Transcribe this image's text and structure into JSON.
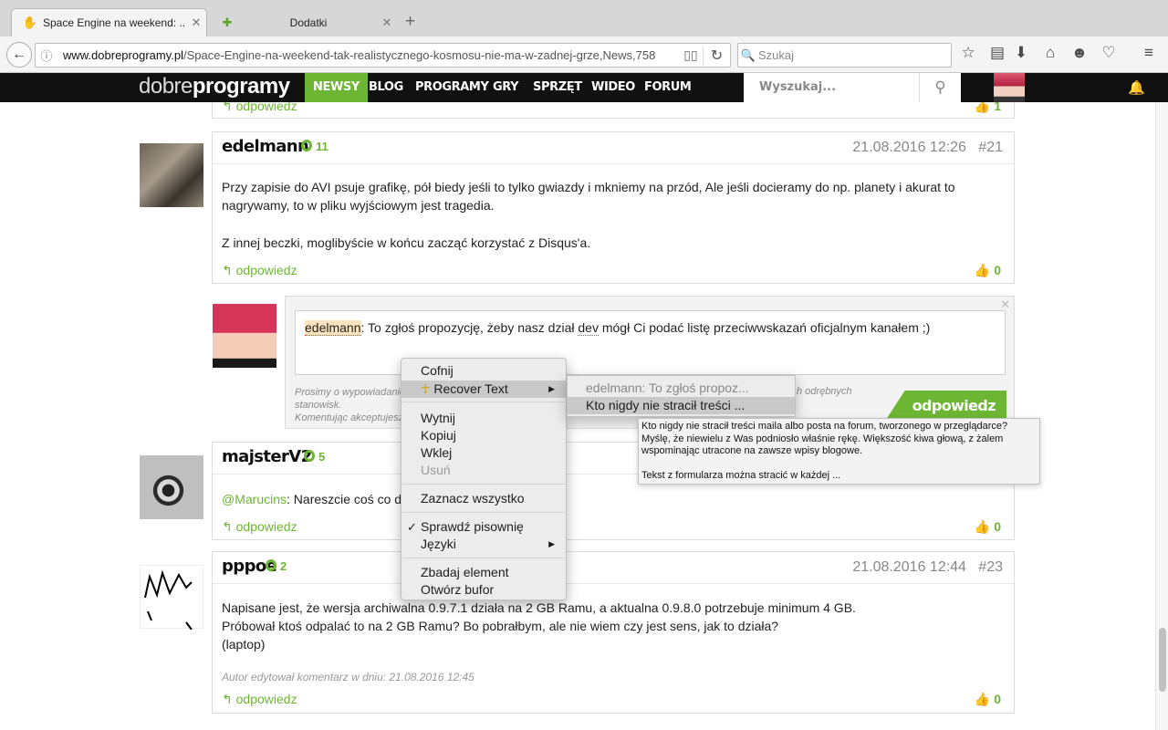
{
  "browser": {
    "tabs": [
      {
        "title": "Space Engine na weekend: ...",
        "icon": "dobreprogramy-favicon"
      },
      {
        "title": "Dodatki",
        "icon": "puzzle-icon"
      }
    ],
    "close_glyph": "✕",
    "new_tab_glyph": "+",
    "url_domain": "www.dobreprogramy.pl",
    "url_path": "/Space-Engine-na-weekend-tak-realistycznego-kosmosu-nie-ma-w-zadnej-grze,News,758",
    "search_placeholder": "Szukaj"
  },
  "site": {
    "logo_light": "dobre",
    "logo_bold": "programy",
    "menu": [
      "NEWSY",
      "BLOG",
      "PROGRAMY",
      "GRY",
      "SPRZĘT",
      "WIDEO",
      "FORUM"
    ],
    "active_menu": "NEWSY",
    "search_placeholder": "Wyszukaj...",
    "accent": "#6cb633"
  },
  "top_strip": {
    "reply": "odpowiedz",
    "likes": "1"
  },
  "comments": [
    {
      "user": "edelmann",
      "rank": "11",
      "date": "21.08.2016 12:26",
      "num": "#21",
      "p1": "Przy zapisie do AVI psuje grafikę, pół biedy jeśli to tylko gwiazdy i mkniemy na przód, Ale jeśli docieramy do np. planety i akurat to nagrywamy, to w pliku wyjściowym jest tragedia.",
      "p2": "Z innej beczki, moglibyście w końcu zacząć korzystać z Disqus'a.",
      "reply": "odpowiedz",
      "likes": "0"
    },
    {
      "user": "majsterV2",
      "rank": "5",
      "mention": "@Marucins",
      "text": ": Nareszcie coś co d",
      "reply": "odpowiedz",
      "likes": "0"
    },
    {
      "user": "pppoe",
      "rank": "2",
      "date": "21.08.2016 12:44",
      "num": "#23",
      "l1": "Napisane jest, że wersja archiwalna 0.9.7.1 działa na 2 GB Ramu, a aktualna 0.9.8.0 potrzebuje minimum 4 GB.",
      "l2": "Próbował ktoś odpalać to na 2 GB Ramu? Bo pobrałbym, ale nie wiem czy jest sens, jak to działa?",
      "l3": "(laptop)",
      "edited": "Autor edytował komentarz w dniu: 21.08.2016 12:45",
      "reply": "odpowiedz",
      "likes": "0"
    }
  ],
  "reply_box": {
    "mention": "edelmann",
    "text_a": ": To zgłoś propozycję, żeby nasz dział ",
    "text_dev": "dev",
    "text_b": " mógł Ci podać listę przeciwwskazań oficjalnym kanałem ;)",
    "disclaimer1": "Prosimy o wypowiadanie",
    "disclaimer1b": "h odrębnych",
    "disclaimer2": "stanowisk.",
    "disclaimer3": "Komentując akceptujesz",
    "button": "odpowiedz"
  },
  "context_menu": {
    "undo": "Cofnij",
    "recover": "Recover Text",
    "cut": "Wytnij",
    "copy": "Kopiuj",
    "paste": "Wklej",
    "delete": "Usuń",
    "select_all": "Zaznacz wszystko",
    "spellcheck": "Sprawdź pisownię",
    "languages": "Języki",
    "inspect": "Zbadaj element",
    "open_buffer": "Otwórz bufor",
    "check_glyph": "✓",
    "arrow_glyph": "▶"
  },
  "submenu": {
    "item1": "edelmann: To zgłoś propoz...",
    "item2": "Kto nigdy nie stracił treści ..."
  },
  "tooltip": {
    "l1": "Kto nigdy nie stracił treści maila albo posta na forum, tworzonego w przeglądarce?",
    "l2": "Myślę, że niewielu z Was podniosło właśnie rękę. Większość kiwa głową, z żalem",
    "l3": "wspominając utracone na zawsze wpisy blogowe.",
    "l4": "Tekst z formularza można stracić w każdej ..."
  }
}
